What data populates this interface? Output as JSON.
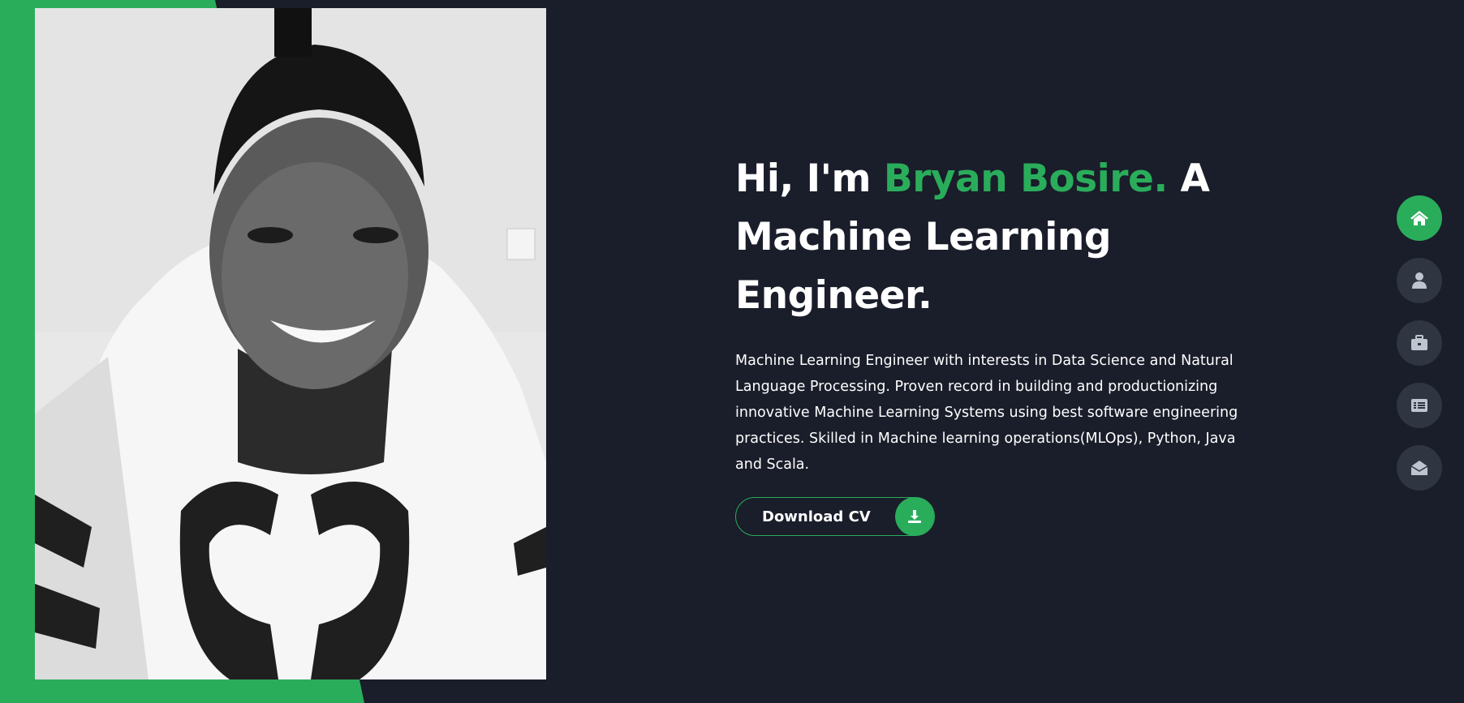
{
  "colors": {
    "background": "#1a1d2a",
    "accent": "#2aad5b",
    "nav_inactive": "#2f3541",
    "nav_icon": "#bfc5cf"
  },
  "hero": {
    "greeting": "Hi, I'm ",
    "name": "Bryan Bosire.",
    "role_line_1": " A",
    "role_line_2": "Machine Learning",
    "role_line_3": "Engineer.",
    "description": "Machine Learning Engineer with interests in Data Science and Natural Language Processing. Proven record in building and productionizing innovative Machine Learning Systems using best software engineering practices. Skilled in Machine learning operations(MLOps), Python, Java and Scala.",
    "cv_button_label": "Download CV",
    "cv_button_icon": "download-icon"
  },
  "nav": {
    "items": [
      {
        "icon": "home-icon",
        "active": true
      },
      {
        "icon": "user-icon",
        "active": false
      },
      {
        "icon": "briefcase-icon",
        "active": false
      },
      {
        "icon": "list-icon",
        "active": false
      },
      {
        "icon": "envelope-open-icon",
        "active": false
      }
    ]
  }
}
